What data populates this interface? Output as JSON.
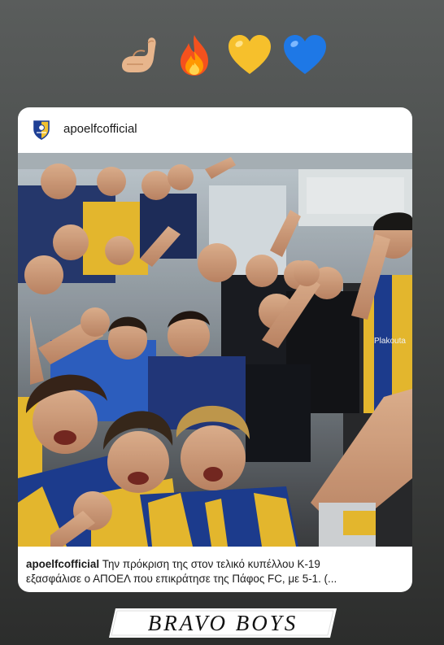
{
  "story": {
    "emojis": [
      {
        "name": "pinched-fingers-icon",
        "glyph": "🤌"
      },
      {
        "name": "fire-icon",
        "glyph": "🔥"
      },
      {
        "name": "yellow-heart-icon",
        "glyph": "💛"
      },
      {
        "name": "blue-heart-icon",
        "glyph": "💙"
      }
    ],
    "post": {
      "username": "apoelfcofficial",
      "caption_username": "apoelfcofficial",
      "caption_line1": " Την πρόκριση της στον τελικό κυπέλλου Κ-19",
      "caption_line2": "εξασφάλισε ο ΑΠΟΕΛ που επικράτησε της Πάφος FC, με 5-1. (...",
      "sponsor_text": "Plakouta"
    },
    "sticker_text": "BRAVO BOYS",
    "colors": {
      "club_yellow": "#f2c230",
      "club_blue": "#1e3f95",
      "card_bg": "#ffffff"
    }
  }
}
